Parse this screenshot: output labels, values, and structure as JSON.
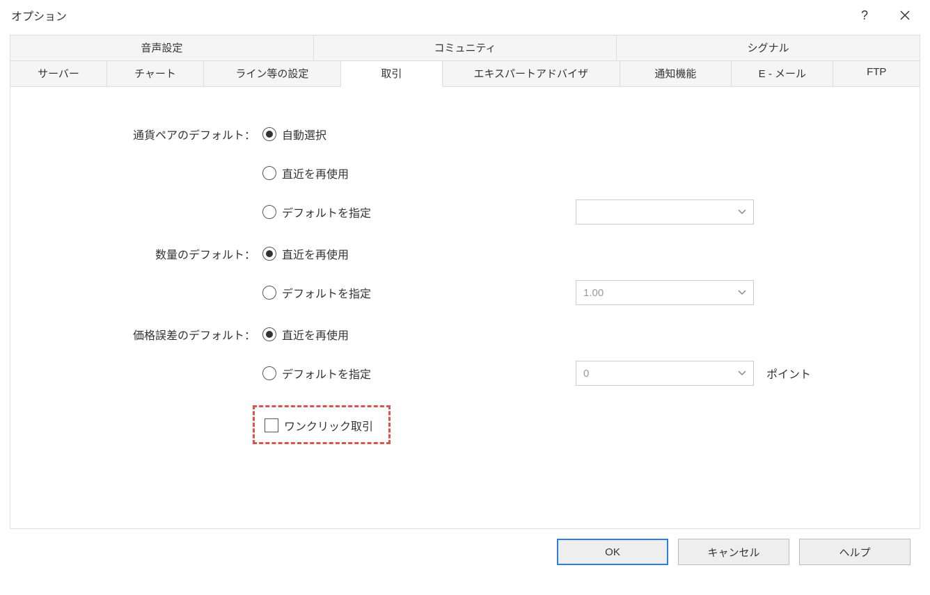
{
  "window": {
    "title": "オプション"
  },
  "tabs": {
    "top": [
      "音声設定",
      "コミュニティ",
      "シグナル"
    ],
    "bottom": [
      "サーバー",
      "チャート",
      "ライン等の設定",
      "取引",
      "エキスパートアドバイザ",
      "通知機能",
      "E - メール",
      "FTP"
    ],
    "active": "取引"
  },
  "form": {
    "symbol": {
      "label": "通貨ペアのデフォルト：",
      "options": {
        "auto": "自動選択",
        "reuse": "直近を再使用",
        "specify": "デフォルトを指定"
      },
      "selected": "auto",
      "specify_value": ""
    },
    "volume": {
      "label": "数量のデフォルト：",
      "options": {
        "reuse": "直近を再使用",
        "specify": "デフォルトを指定"
      },
      "selected": "reuse",
      "specify_value": "1.00"
    },
    "deviation": {
      "label": "価格誤差のデフォルト：",
      "options": {
        "reuse": "直近を再使用",
        "specify": "デフォルトを指定"
      },
      "selected": "reuse",
      "specify_value": "0",
      "unit": "ポイント"
    },
    "one_click": {
      "label": "ワンクリック取引",
      "checked": false
    }
  },
  "buttons": {
    "ok": "OK",
    "cancel": "キャンセル",
    "help": "ヘルプ"
  }
}
